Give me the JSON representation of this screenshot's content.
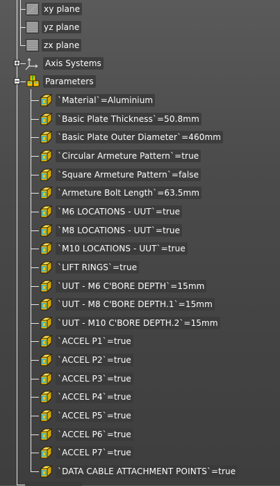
{
  "tree": {
    "planes": [
      {
        "label": "xy plane",
        "icon": "plane-icon"
      },
      {
        "label": "yz plane",
        "icon": "plane-icon"
      },
      {
        "label": "zx plane",
        "icon": "plane-icon"
      }
    ],
    "axis_systems": {
      "label": "Axis Systems",
      "expander": "plus",
      "icon": "axis-system-icon"
    },
    "parameters": {
      "label": "Parameters",
      "expander": "minus",
      "icon": "parameters-set-icon"
    },
    "parameter_items": [
      "`Material`=Aluminium",
      "`Basic Plate Thickness`=50.8mm",
      "`Basic Plate Outer Diameter`=460mm",
      "`Circular Armeture Pattern`=true",
      "`Square Armeture Pattern`=false",
      "`Armeture Bolt Length`=63.5mm",
      "`M6 LOCATIONS - UUT`=true",
      "`M8 LOCATIONS - UUT`=true",
      "`M10 LOCATIONS - UUT`=true",
      "`LIFT RINGS`=true",
      "`UUT - M6 C'BORE DEPTH`=15mm",
      "`UUT - M8 C'BORE DEPTH.1`=15mm",
      "`UUT - M10 C'BORE DEPTH.2`=15mm",
      "`ACCEL P1`=true",
      "`ACCEL P2`=true",
      "`ACCEL P3`=true",
      "`ACCEL P4`=true",
      "`ACCEL P5`=true",
      "`ACCEL P6`=true",
      "`ACCEL P7`=true",
      "`DATA CABLE ATTACHMENT POINTS`=true"
    ]
  },
  "colors": {
    "background": "#4b4b4b",
    "tree_line": "#e8e8e8",
    "label_bg": "#3a3a3a",
    "text": "#ffffff",
    "param_icon": "#f5c400",
    "param_icon_accent": "#2fb4d8"
  }
}
